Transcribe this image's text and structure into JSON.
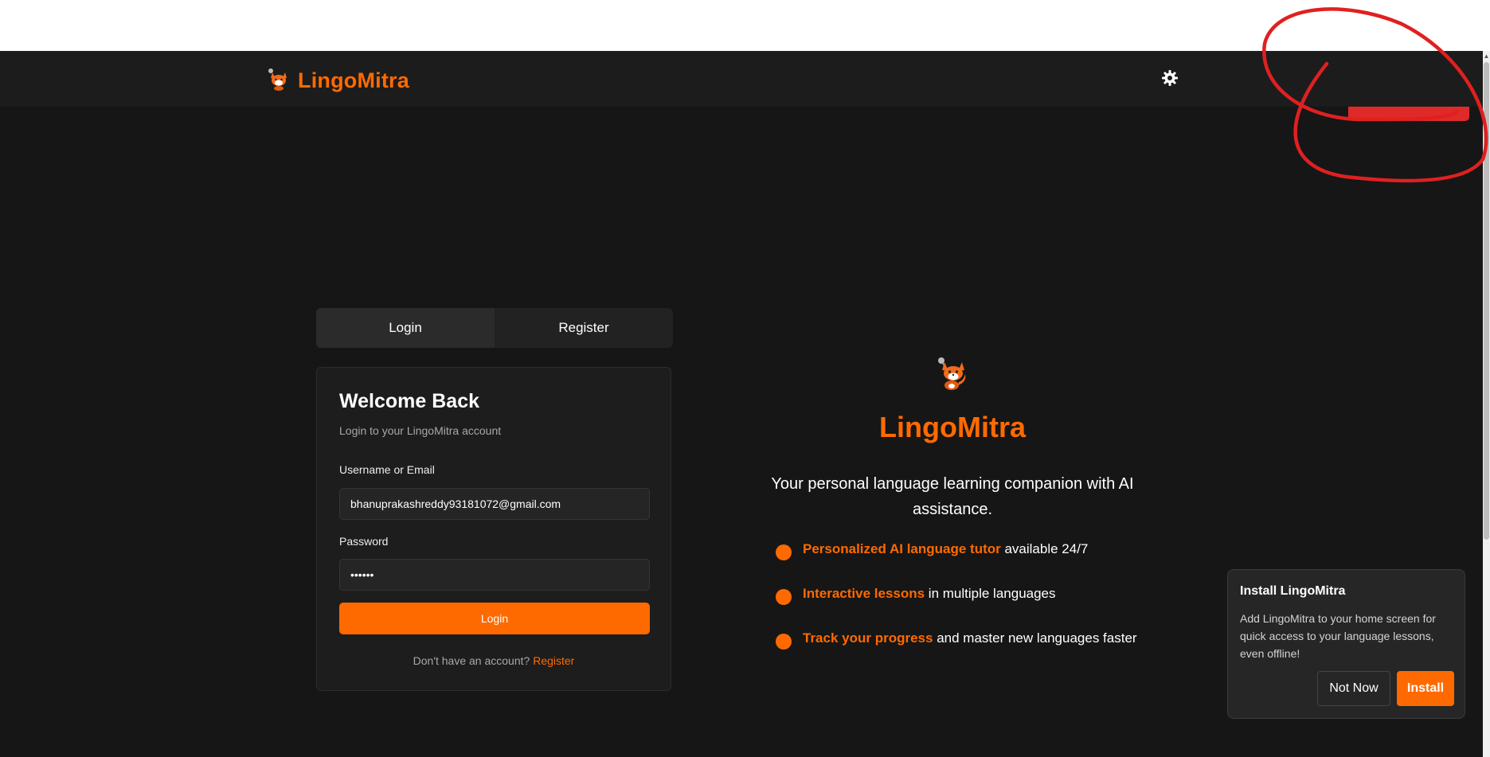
{
  "app": {
    "name": "LingoMitra"
  },
  "colors": {
    "accent": "#ff6a00",
    "background": "#161616",
    "annotation": "#e02020"
  },
  "header": {
    "logo_icon": "fox-mascot-icon",
    "brand": "LingoMitra",
    "theme_icon": "gear-sun-icon"
  },
  "auth_tabs": [
    {
      "label": "Login",
      "active": true
    },
    {
      "label": "Register",
      "active": false
    }
  ],
  "login_card": {
    "title": "Welcome Back",
    "subtitle": "Login to your LingoMitra account",
    "username_label": "Username or Email",
    "username_value": "bhanuprakashreddy93181072@gmail.com",
    "password_label": "Password",
    "password_value": "••••••",
    "submit_label": "Login",
    "switch_prefix": "Don't have an account?",
    "switch_link": "Register"
  },
  "hero": {
    "logo_icon": "fox-mascot-icon",
    "title": "LingoMitra",
    "tagline": "Your personal language learning companion with AI assistance.",
    "features": [
      {
        "highlight": "Personalized AI language tutor",
        "text": " available 24/7"
      },
      {
        "highlight": "Interactive lessons",
        "text": " in multiple languages"
      },
      {
        "highlight": "Track your progress",
        "text": " and master new languages faster"
      }
    ]
  },
  "install_prompt": {
    "title": "Install LingoMitra",
    "body": "Add LingoMitra to your home screen for quick access to your language lessons, even offline!",
    "dismiss_label": "Not Now",
    "install_label": "Install"
  }
}
